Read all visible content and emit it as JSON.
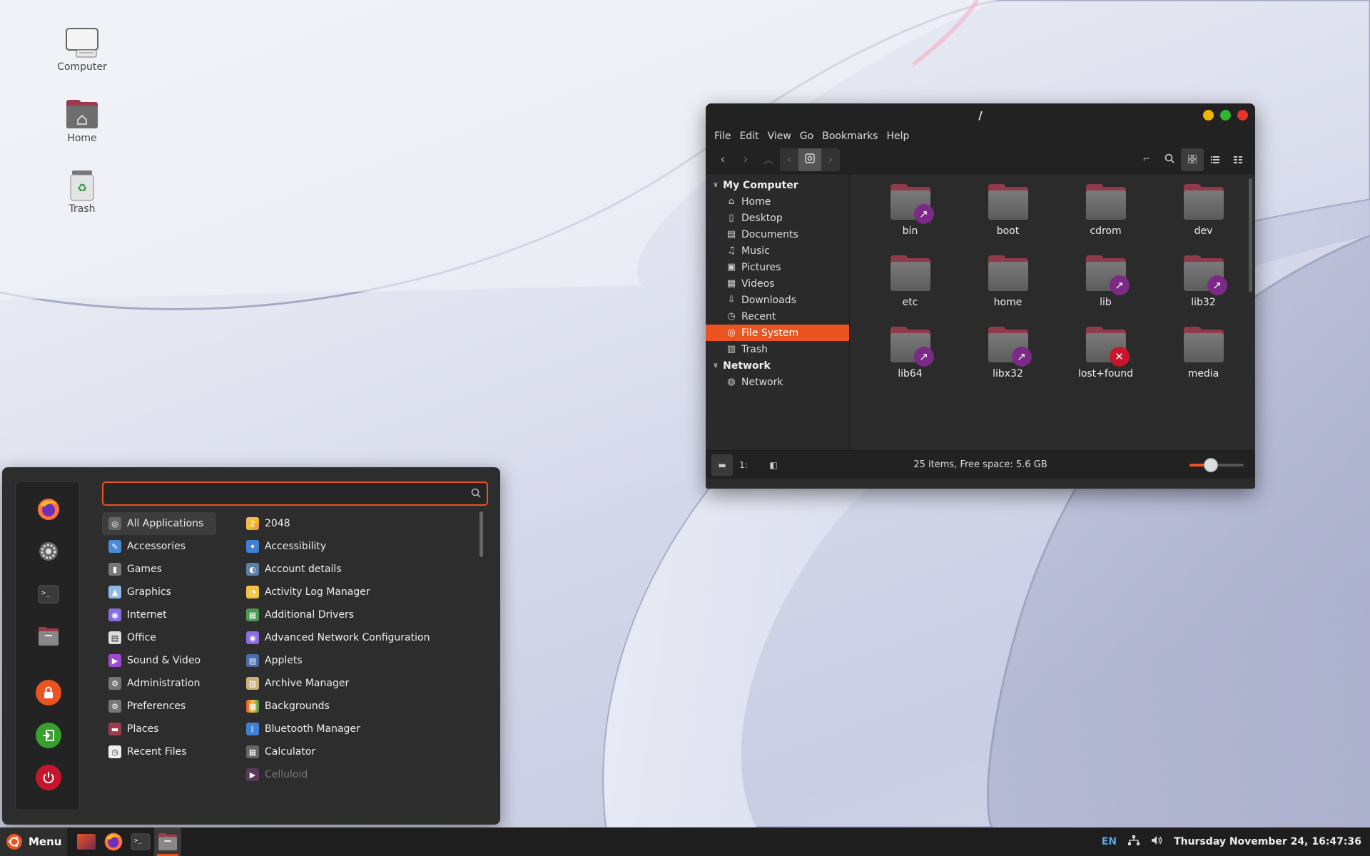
{
  "desktop": {
    "icons": [
      {
        "label": "Computer"
      },
      {
        "label": "Home"
      },
      {
        "label": "Trash"
      }
    ]
  },
  "file_manager": {
    "title": "/",
    "menu": [
      "File",
      "Edit",
      "View",
      "Go",
      "Bookmarks",
      "Help"
    ],
    "sidebar": {
      "my_computer": "My Computer",
      "items": [
        "Home",
        "Desktop",
        "Documents",
        "Music",
        "Pictures",
        "Videos",
        "Downloads",
        "Recent",
        "File System",
        "Trash"
      ],
      "network_head": "Network",
      "network_items": [
        "Network"
      ]
    },
    "files": [
      {
        "name": "bin",
        "badge": "link"
      },
      {
        "name": "boot",
        "badge": ""
      },
      {
        "name": "cdrom",
        "badge": ""
      },
      {
        "name": "dev",
        "badge": ""
      },
      {
        "name": "etc",
        "badge": ""
      },
      {
        "name": "home",
        "badge": ""
      },
      {
        "name": "lib",
        "badge": "link"
      },
      {
        "name": "lib32",
        "badge": "link"
      },
      {
        "name": "lib64",
        "badge": "link"
      },
      {
        "name": "libx32",
        "badge": "link"
      },
      {
        "name": "lost+found",
        "badge": "blocked"
      },
      {
        "name": "media",
        "badge": ""
      }
    ],
    "status": "25 items, Free space: 5.6 GB",
    "zoom_level": 0.4
  },
  "start_menu": {
    "search_placeholder": "",
    "categories": [
      "All Applications",
      "Accessories",
      "Games",
      "Graphics",
      "Internet",
      "Office",
      "Sound & Video",
      "Administration",
      "Preferences",
      "Places",
      "Recent Files"
    ],
    "apps": [
      "2048",
      "Accessibility",
      "Account details",
      "Activity Log Manager",
      "Additional Drivers",
      "Advanced Network Configuration",
      "Applets",
      "Archive Manager",
      "Backgrounds",
      "Bluetooth Manager",
      "Calculator",
      "Celluloid"
    ]
  },
  "taskbar": {
    "menu_label": "Menu",
    "lang": "EN",
    "clock": "Thursday November 24, 16:47:36"
  },
  "colors": {
    "accent": "#e95420",
    "link_badge": "#7b2a85",
    "blocked_badge": "#c7162b"
  }
}
